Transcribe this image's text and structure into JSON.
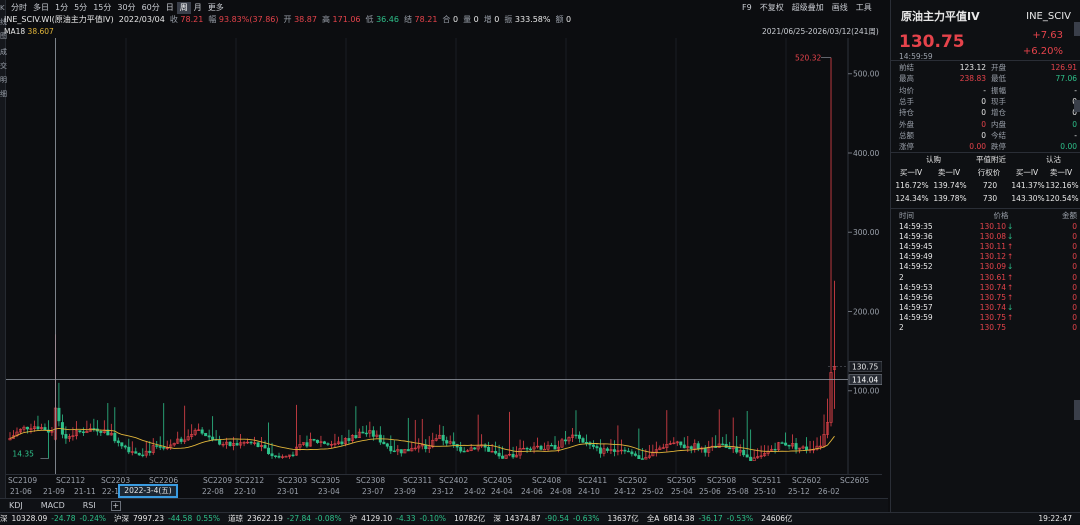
{
  "left_strip": {
    "chars": [
      "K",
      "线",
      "图",
      "",
      "成",
      "交",
      "明",
      "细"
    ]
  },
  "period_tabs": [
    {
      "label": "分时",
      "active": false
    },
    {
      "label": "多日",
      "active": false
    },
    {
      "label": "1分",
      "active": false
    },
    {
      "label": "5分",
      "active": false
    },
    {
      "label": "15分",
      "active": false
    },
    {
      "label": "30分",
      "active": false
    },
    {
      "label": "60分",
      "active": false
    },
    {
      "label": "日",
      "active": false
    },
    {
      "label": "周",
      "active": true
    },
    {
      "label": "月",
      "active": false
    },
    {
      "label": "更多",
      "active": false
    }
  ],
  "toolbar_right": [
    "F9",
    "不复权",
    "超级叠加",
    "画线",
    "工具"
  ],
  "info": {
    "symbol": "INE_SCIV.WI(原油主力平值IV)",
    "date": "2022/03/04",
    "close_label": "收",
    "close": "78.21",
    "chg_label": "幅",
    "chg": "93.83%(37.86)",
    "open_label": "开",
    "open": "38.87",
    "high_label": "高",
    "high": "171.06",
    "low_label": "低",
    "low": "36.46",
    "settle_label": "结",
    "settle": "78.21",
    "oi_label": "合",
    "oi": "0",
    "vol_label": "量",
    "vol": "0",
    "inc_label": "增",
    "inc": "0",
    "amp_label": "振",
    "amp": "333.58%",
    "amt_label": "额",
    "amt": "0"
  },
  "ma": {
    "label": "MA18",
    "value": "38.607"
  },
  "date_range": "2021/06/25-2026/03/12(241周)",
  "chart_data": {
    "type": "candlestick",
    "y_ticks": [
      "500.00",
      "400.00",
      "300.00",
      "200.00",
      "100.00"
    ],
    "ylim": [
      0,
      535
    ],
    "y_tick_values": [
      500,
      400,
      300,
      200,
      100
    ],
    "max_label": "520.32",
    "min_label": "14.35",
    "max_value": 520.32,
    "min_value": 14.35,
    "current_price_label": "130.75",
    "current_price": 130.75,
    "crosshair_label": "114.04",
    "crosshair_value": 114.04,
    "contract_labels": [
      "SC2109",
      "SC2112",
      "SC2203",
      "SC2206",
      "SC2209",
      "SC2212",
      "SC2303",
      "SC2305",
      "SC2308",
      "SC2311",
      "SC2402",
      "SC2405",
      "SC2408",
      "SC2411",
      "SC2502",
      "SC2505",
      "SC2508",
      "SC2511",
      "SC2602",
      "SC2605"
    ],
    "date_labels": [
      "21-06",
      "21-09",
      "21-11",
      "22-1",
      "22-08",
      "22-10",
      "23-01",
      "23-04",
      "23-07",
      "23-09",
      "23-12",
      "24-02",
      "24-04",
      "24-06",
      "24-08",
      "24-10",
      "24-12",
      "25-02",
      "25-04",
      "25-06",
      "25-08",
      "25-10",
      "25-12",
      "26-02"
    ],
    "series_summary": "weekly candles, baseline ~30-60, spike 2022-03 to 171, spike 2026-03 to 520"
  },
  "x_cursor_label": "2022-3-4(五)",
  "indicator_tabs": [
    "KDJ",
    "MACD",
    "RSI"
  ],
  "status_bar": [
    {
      "label": "深",
      "value": "10328.09",
      "chg": "-24.78",
      "pct": "-0.24%",
      "dir": "down"
    },
    {
      "label": "沪深",
      "value": "7997.23",
      "chg": "-44.58",
      "pct": "0.55%",
      "dir": "down"
    },
    {
      "label": "道琼",
      "value": "23622.19",
      "chg": "-27.84",
      "pct": "-0.08%",
      "dir": "down"
    },
    {
      "label": "沪",
      "value": "4129.10",
      "chg": "-4.33",
      "pct": "-0.10%",
      "dir": "down"
    },
    {
      "label": "",
      "value": "10782亿",
      "chg": "",
      "pct": "",
      "dir": "flat"
    },
    {
      "label": "深",
      "value": "14374.87",
      "chg": "-90.54",
      "pct": "-0.63%",
      "dir": "down"
    },
    {
      "label": "",
      "value": "13637亿",
      "chg": "",
      "pct": "",
      "dir": "flat"
    },
    {
      "label": "全A",
      "value": "6814.38",
      "chg": "-36.17",
      "pct": "-0.53%",
      "dir": "down"
    },
    {
      "label": "",
      "value": "24606亿",
      "chg": "",
      "pct": "",
      "dir": "flat"
    }
  ],
  "clock": "19:22:47",
  "panel": {
    "name": "原油主力平值IV",
    "code": "INE_SCIV",
    "price": "130.75",
    "change": "+7.63",
    "change_pct": "+6.20%",
    "time": "14:59:59",
    "stats": [
      {
        "l1": "前结",
        "v1": "123.12",
        "c1": "white",
        "l2": "开盘",
        "v2": "126.91",
        "c2": "red"
      },
      {
        "l1": "最高",
        "v1": "238.83",
        "c1": "red",
        "l2": "最低",
        "v2": "77.06",
        "c2": "green"
      },
      {
        "l1": "均价",
        "v1": "-",
        "c1": "white",
        "l2": "振幅",
        "v2": "-",
        "c2": "white"
      },
      {
        "l1": "总手",
        "v1": "0",
        "c1": "white",
        "l2": "现手",
        "v2": "0",
        "c2": "white"
      },
      {
        "l1": "持仓",
        "v1": "0",
        "c1": "white",
        "l2": "增仓",
        "v2": "0",
        "c2": "white"
      },
      {
        "l1": "外盘",
        "v1": "0",
        "c1": "red",
        "l2": "内盘",
        "v2": "0",
        "c2": "green"
      },
      {
        "l1": "总额",
        "v1": "0",
        "c1": "white",
        "l2": "今结",
        "v2": "-",
        "c2": "white"
      },
      {
        "l1": "涨停",
        "v1": "0.00",
        "c1": "red",
        "l2": "跌停",
        "v2": "0.00",
        "c2": "green"
      }
    ],
    "iv_headers": [
      "认购",
      "平值附近",
      "认沽"
    ],
    "iv_subheaders": [
      "买一IV",
      "卖一IV",
      "行权价",
      "买一IV",
      "卖一IV"
    ],
    "iv_rows": [
      [
        "116.72%",
        "139.74%",
        "720",
        "141.37%",
        "132.16%"
      ],
      [
        "124.34%",
        "139.78%",
        "730",
        "143.30%",
        "120.54%"
      ]
    ],
    "trade_headers": [
      "时间",
      "价格",
      "金额"
    ],
    "trades": [
      {
        "time": "14:59:35",
        "price": "130.10",
        "arrow": "↓",
        "dir": "down",
        "amt": "0"
      },
      {
        "time": "14:59:36",
        "price": "130.08",
        "arrow": "↓",
        "dir": "down",
        "amt": "0"
      },
      {
        "time": "14:59:45",
        "price": "130.11",
        "arrow": "↑",
        "dir": "up",
        "amt": "0"
      },
      {
        "time": "14:59:49",
        "price": "130.12",
        "arrow": "↑",
        "dir": "up",
        "amt": "0"
      },
      {
        "time": "14:59:52",
        "price": "130.09",
        "arrow": "↓",
        "dir": "down",
        "amt": "0"
      },
      {
        "time": "2",
        "price": "130.61",
        "arrow": "↑",
        "dir": "up",
        "amt": "0"
      },
      {
        "time": "14:59:53",
        "price": "130.74",
        "arrow": "↑",
        "dir": "up",
        "amt": "0"
      },
      {
        "time": "14:59:56",
        "price": "130.75",
        "arrow": "↑",
        "dir": "up",
        "amt": "0"
      },
      {
        "time": "14:59:57",
        "price": "130.74",
        "arrow": "↓",
        "dir": "down",
        "amt": "0"
      },
      {
        "time": "14:59:59",
        "price": "130.75",
        "arrow": "↑",
        "dir": "up",
        "amt": "0"
      },
      {
        "time": "2",
        "price": "130.75",
        "arrow": "",
        "dir": "up",
        "amt": "0"
      }
    ]
  },
  "colors": {
    "up": "#e5434b",
    "down": "#2ec08a",
    "ma": "#e0b43a",
    "bg": "#0c0d10",
    "accent": "#3a9be0"
  }
}
